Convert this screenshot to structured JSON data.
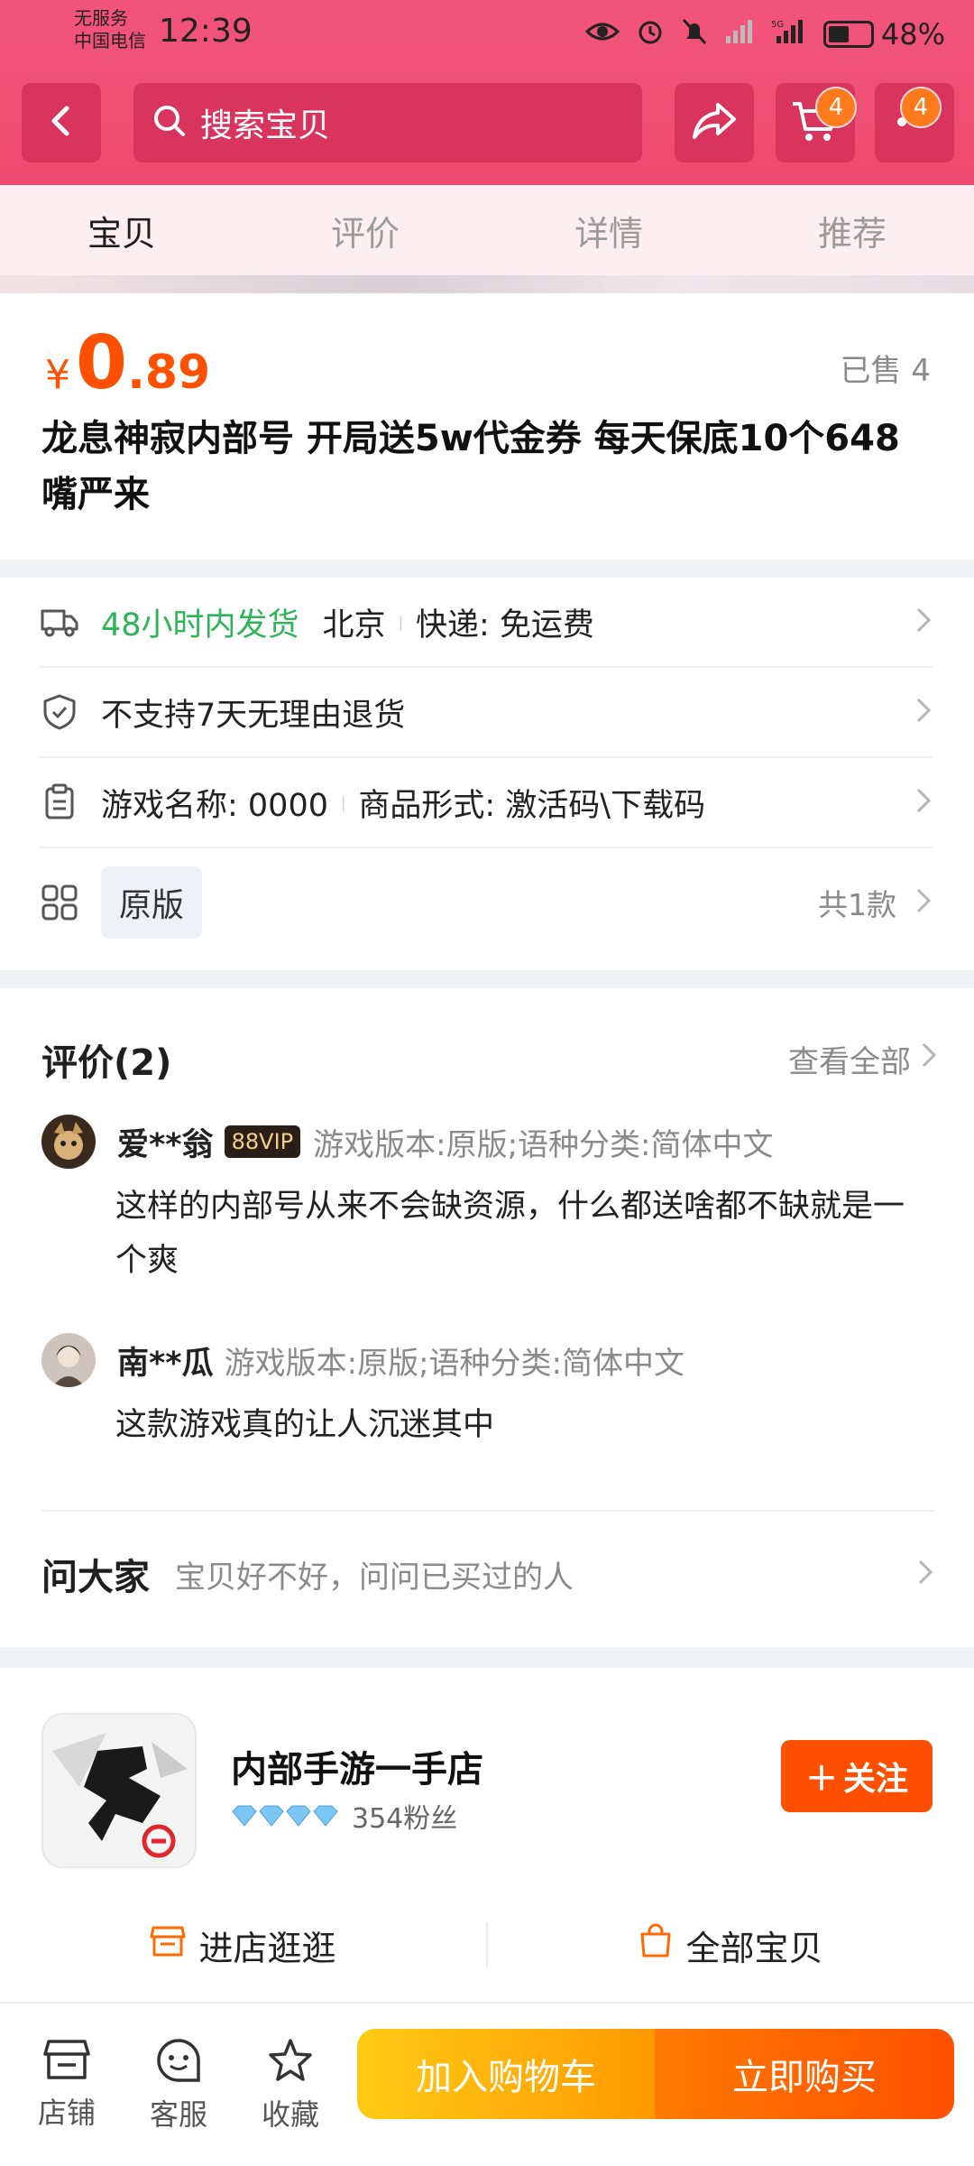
{
  "status_bar": {
    "carrier_line1": "无服务",
    "carrier_line2": "中国电信",
    "time": "12:39",
    "battery": "48%"
  },
  "header": {
    "search_placeholder": "搜索宝贝",
    "cart_badge": "4",
    "more_badge": "4"
  },
  "tabs": [
    {
      "label": "宝贝",
      "active": true
    },
    {
      "label": "评价",
      "active": false
    },
    {
      "label": "详情",
      "active": false
    },
    {
      "label": "推荐",
      "active": false
    }
  ],
  "product": {
    "currency": "¥",
    "price_int": "0",
    "price_dec": ".89",
    "sold": "已售 4",
    "title": "龙息神寂内部号 开局送5w代金券  每天保底10个648  嘴严来"
  },
  "info": {
    "shipping_time": "48小时内发货",
    "shipping_from": "北京",
    "shipping_fee": "快递: 免运费",
    "return_policy": "不支持7天无理由退货",
    "game_name": "游戏名称: 0000",
    "product_form": "商品形式: 激活码\\下载码",
    "variant": "原版",
    "variant_count": "共1款"
  },
  "reviews": {
    "title": "评价(2)",
    "view_all": "查看全部",
    "items": [
      {
        "user": "爱**翁",
        "vip": "88VIP",
        "spec": "游戏版本:原版;语种分类:简体中文",
        "text": "这样的内部号从来不会缺资源，什么都送啥都不缺就是一个爽"
      },
      {
        "user": "南**瓜",
        "vip": "",
        "spec": "游戏版本:原版;语种分类:简体中文",
        "text": "这款游戏真的让人沉迷其中"
      }
    ],
    "ask_title": "问大家",
    "ask_sub": "宝贝好不好，问问已买过的人"
  },
  "shop": {
    "name": "内部手游一手店",
    "fans": "354粉丝",
    "follow": "关注",
    "enter_shop": "进店逛逛",
    "all_items": "全部宝贝"
  },
  "bottom_bar": {
    "store": "店铺",
    "service": "客服",
    "favorite": "收藏",
    "add_cart": "加入购物车",
    "buy_now": "立即购买"
  },
  "colors": {
    "header": "#ef4a6f",
    "price": "#ff5000",
    "green": "#2bb556"
  }
}
